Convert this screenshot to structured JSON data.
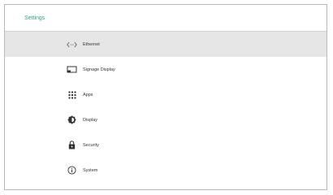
{
  "header": {
    "title": "Settings"
  },
  "menu": {
    "items": [
      {
        "label": "Ethernet",
        "icon": "ethernet-icon",
        "selected": true
      },
      {
        "label": "Signage Display",
        "icon": "signage-display-icon",
        "selected": false
      },
      {
        "label": "Apps",
        "icon": "apps-grid-icon",
        "selected": false
      },
      {
        "label": "Display",
        "icon": "brightness-icon",
        "selected": false
      },
      {
        "label": "Security",
        "icon": "lock-icon",
        "selected": false
      },
      {
        "label": "System",
        "icon": "info-icon",
        "selected": false
      }
    ]
  },
  "colors": {
    "accent": "#3a9f8a",
    "selected_background": "#e6e6e6",
    "border": "#b9b9b9"
  }
}
